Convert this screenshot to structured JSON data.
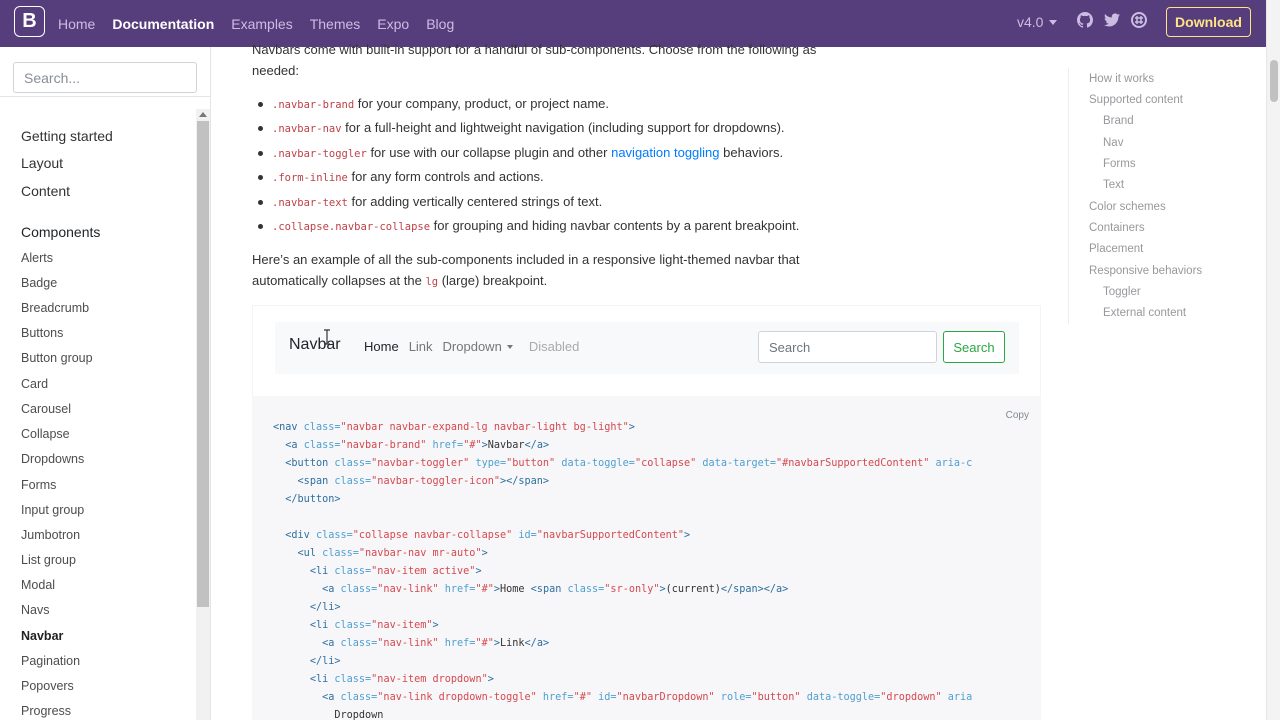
{
  "topbar": {
    "logo": "B",
    "nav": [
      "Home",
      "Documentation",
      "Examples",
      "Themes",
      "Expo",
      "Blog"
    ],
    "active": "Documentation",
    "version": "v4.0",
    "icons": [
      "github-icon",
      "twitter-icon",
      "slack-icon"
    ],
    "download": "Download",
    "colors": {
      "bg": "#563d7c",
      "download": "#ffe484"
    }
  },
  "sidebar": {
    "search_placeholder": "Search...",
    "sections": [
      "Getting started",
      "Layout",
      "Content",
      "Components"
    ],
    "items": [
      "Alerts",
      "Badge",
      "Breadcrumb",
      "Buttons",
      "Button group",
      "Card",
      "Carousel",
      "Collapse",
      "Dropdowns",
      "Forms",
      "Input group",
      "Jumbotron",
      "List group",
      "Modal",
      "Navs",
      "Navbar",
      "Pagination",
      "Popovers",
      "Progress"
    ],
    "active": "Navbar"
  },
  "main": {
    "intro": "Navbars come with built-in support for a handful of sub-components. Choose from the following as needed:",
    "bullets": [
      {
        "code": ".navbar-brand",
        "text": " for your company, product, or project name."
      },
      {
        "code": ".navbar-nav",
        "text": " for a full-height and lightweight navigation (including support for dropdowns)."
      },
      {
        "code": ".navbar-toggler",
        "text": " for use with our collapse plugin and other ",
        "link": "navigation toggling",
        "after": " behaviors."
      },
      {
        "code": ".form-inline",
        "text": " for any form controls and actions."
      },
      {
        "code": ".navbar-text",
        "text": " for adding vertically centered strings of text."
      },
      {
        "code": ".collapse.navbar-collapse",
        "text": " for grouping and hiding navbar contents by a parent breakpoint."
      }
    ],
    "example_intro_a": "Here’s an example of all the sub-components included in a responsive light-themed navbar that automatically collapses at the ",
    "example_intro_code": "lg",
    "example_intro_b": " (large) breakpoint.",
    "demo": {
      "brand": "Navbar",
      "links": [
        "Home",
        "Link",
        "Dropdown",
        "Disabled"
      ],
      "search_placeholder": "Search",
      "search_button": "Search"
    },
    "copy_label": "Copy",
    "code": [
      [
        [
          "t",
          "<nav "
        ],
        [
          "a",
          "class="
        ],
        [
          "v",
          "\"navbar navbar-expand-lg navbar-light bg-light\""
        ],
        [
          "t",
          ">"
        ]
      ],
      [
        [
          "p",
          "  "
        ],
        [
          "t",
          "<a "
        ],
        [
          "a",
          "class="
        ],
        [
          "v",
          "\"navbar-brand\""
        ],
        [
          "a",
          " href="
        ],
        [
          "v",
          "\"#\""
        ],
        [
          "t",
          ">"
        ],
        [
          "p",
          "Navbar"
        ],
        [
          "t",
          "</a>"
        ]
      ],
      [
        [
          "p",
          "  "
        ],
        [
          "t",
          "<button "
        ],
        [
          "a",
          "class="
        ],
        [
          "v",
          "\"navbar-toggler\""
        ],
        [
          "a",
          " type="
        ],
        [
          "v",
          "\"button\""
        ],
        [
          "a",
          " data-toggle="
        ],
        [
          "v",
          "\"collapse\""
        ],
        [
          "a",
          " data-target="
        ],
        [
          "v",
          "\"#navbarSupportedContent\""
        ],
        [
          "a",
          " aria-c"
        ]
      ],
      [
        [
          "p",
          "    "
        ],
        [
          "t",
          "<span "
        ],
        [
          "a",
          "class="
        ],
        [
          "v",
          "\"navbar-toggler-icon\""
        ],
        [
          "t",
          "></span>"
        ]
      ],
      [
        [
          "p",
          "  "
        ],
        [
          "t",
          "</button>"
        ]
      ],
      [
        [
          "p",
          ""
        ]
      ],
      [
        [
          "p",
          "  "
        ],
        [
          "t",
          "<div "
        ],
        [
          "a",
          "class="
        ],
        [
          "v",
          "\"collapse navbar-collapse\""
        ],
        [
          "a",
          " id="
        ],
        [
          "v",
          "\"navbarSupportedContent\""
        ],
        [
          "t",
          ">"
        ]
      ],
      [
        [
          "p",
          "    "
        ],
        [
          "t",
          "<ul "
        ],
        [
          "a",
          "class="
        ],
        [
          "v",
          "\"navbar-nav mr-auto\""
        ],
        [
          "t",
          ">"
        ]
      ],
      [
        [
          "p",
          "      "
        ],
        [
          "t",
          "<li "
        ],
        [
          "a",
          "class="
        ],
        [
          "v",
          "\"nav-item active\""
        ],
        [
          "t",
          ">"
        ]
      ],
      [
        [
          "p",
          "        "
        ],
        [
          "t",
          "<a "
        ],
        [
          "a",
          "class="
        ],
        [
          "v",
          "\"nav-link\""
        ],
        [
          "a",
          " href="
        ],
        [
          "v",
          "\"#\""
        ],
        [
          "t",
          ">"
        ],
        [
          "p",
          "Home "
        ],
        [
          "t",
          "<span "
        ],
        [
          "a",
          "class="
        ],
        [
          "v",
          "\"sr-only\""
        ],
        [
          "t",
          ">"
        ],
        [
          "p",
          "(current)"
        ],
        [
          "t",
          "</span></a>"
        ]
      ],
      [
        [
          "p",
          "      "
        ],
        [
          "t",
          "</li>"
        ]
      ],
      [
        [
          "p",
          "      "
        ],
        [
          "t",
          "<li "
        ],
        [
          "a",
          "class="
        ],
        [
          "v",
          "\"nav-item\""
        ],
        [
          "t",
          ">"
        ]
      ],
      [
        [
          "p",
          "        "
        ],
        [
          "t",
          "<a "
        ],
        [
          "a",
          "class="
        ],
        [
          "v",
          "\"nav-link\""
        ],
        [
          "a",
          " href="
        ],
        [
          "v",
          "\"#\""
        ],
        [
          "t",
          ">"
        ],
        [
          "p",
          "Link"
        ],
        [
          "t",
          "</a>"
        ]
      ],
      [
        [
          "p",
          "      "
        ],
        [
          "t",
          "</li>"
        ]
      ],
      [
        [
          "p",
          "      "
        ],
        [
          "t",
          "<li "
        ],
        [
          "a",
          "class="
        ],
        [
          "v",
          "\"nav-item dropdown\""
        ],
        [
          "t",
          ">"
        ]
      ],
      [
        [
          "p",
          "        "
        ],
        [
          "t",
          "<a "
        ],
        [
          "a",
          "class="
        ],
        [
          "v",
          "\"nav-link dropdown-toggle\""
        ],
        [
          "a",
          " href="
        ],
        [
          "v",
          "\"#\""
        ],
        [
          "a",
          " id="
        ],
        [
          "v",
          "\"navbarDropdown\""
        ],
        [
          "a",
          " role="
        ],
        [
          "v",
          "\"button\""
        ],
        [
          "a",
          " data-toggle="
        ],
        [
          "v",
          "\"dropdown\""
        ],
        [
          "a",
          " aria"
        ]
      ],
      [
        [
          "p",
          "          Dropdown"
        ]
      ]
    ]
  },
  "toc": {
    "items": [
      {
        "label": "How it works",
        "level": 1
      },
      {
        "label": "Supported content",
        "level": 1
      },
      {
        "label": "Brand",
        "level": 2
      },
      {
        "label": "Nav",
        "level": 2
      },
      {
        "label": "Forms",
        "level": 2
      },
      {
        "label": "Text",
        "level": 2
      },
      {
        "label": "Color schemes",
        "level": 1
      },
      {
        "label": "Containers",
        "level": 1
      },
      {
        "label": "Placement",
        "level": 1
      },
      {
        "label": "Responsive behaviors",
        "level": 1
      },
      {
        "label": "Toggler",
        "level": 2
      },
      {
        "label": "External content",
        "level": 2
      }
    ]
  }
}
